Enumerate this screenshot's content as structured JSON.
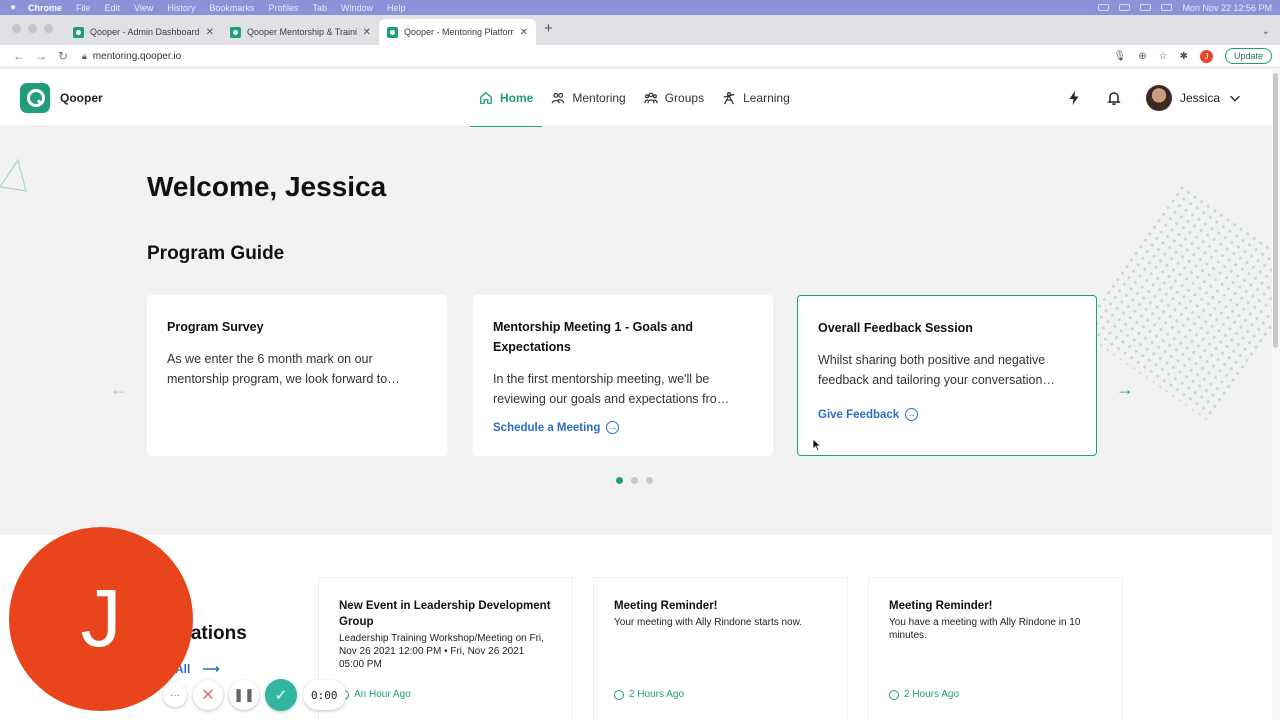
{
  "os_menubar": {
    "apple": "",
    "items": [
      "Chrome",
      "File",
      "Edit",
      "View",
      "History",
      "Bookmarks",
      "Profiles",
      "Tab",
      "Window",
      "Help"
    ],
    "clock": "Mon Nov 22  12:56 PM"
  },
  "browser": {
    "tabs": [
      {
        "title": "Qooper - Admin Dashboard",
        "active": false
      },
      {
        "title": "Qooper Mentorship & Training",
        "active": false
      },
      {
        "title": "Qooper - Mentoring Platform",
        "active": true
      }
    ],
    "new_tab": "+",
    "url": "mentoring.qooper.io",
    "profile_initial": "J",
    "update_label": "Update"
  },
  "app": {
    "brand": "Qooper",
    "nav": [
      {
        "label": "Home",
        "icon": "home-icon",
        "active": true
      },
      {
        "label": "Mentoring",
        "icon": "people-icon",
        "active": false
      },
      {
        "label": "Groups",
        "icon": "group-icon",
        "active": false
      },
      {
        "label": "Learning",
        "icon": "learning-icon",
        "active": false
      }
    ],
    "user_name": "Jessica"
  },
  "hero": {
    "welcome": "Welcome, Jessica",
    "section_title": "Program Guide",
    "cards": [
      {
        "title": "Program Survey",
        "body": "As we enter the 6 month mark on our mentorship program, we look forward to…",
        "action": ""
      },
      {
        "title": "Mentorship Meeting 1 - Goals and Expectations",
        "body": "In the first mentorship meeting, we'll be reviewing our goals and expectations fro…",
        "action": "Schedule a Meeting"
      },
      {
        "title": "Overall Feedback Session",
        "body": "Whilst sharing both positive and negative feedback and tailoring your conversation…",
        "action": "Give Feedback"
      }
    ],
    "pager_total": 3,
    "pager_active": 1
  },
  "notifications": {
    "title": "ications",
    "view_all": "All",
    "items": [
      {
        "title": "New Event in Leadership Development Group",
        "body": "Leadership Training Workshop/Meeting on Fri, Nov 26 2021 12:00 PM • Fri, Nov 26 2021 05:00 PM",
        "time": "An Hour Ago"
      },
      {
        "title": "Meeting Reminder!",
        "body": "Your meeting with Ally Rindone starts now.",
        "time": "2 Hours Ago"
      },
      {
        "title": "Meeting Reminder!",
        "body": "You have a meeting with Ally Rindone in 10 minutes.",
        "time": "2 Hours Ago"
      }
    ]
  },
  "recorder": {
    "initial": "J",
    "more": "···",
    "cancel": "✕",
    "pause": "❚❚",
    "done": "✓",
    "timer": "0:00"
  },
  "colors": {
    "brand": "#1f9d7c",
    "link": "#2e6cc5",
    "recorder": "#e8451c"
  }
}
